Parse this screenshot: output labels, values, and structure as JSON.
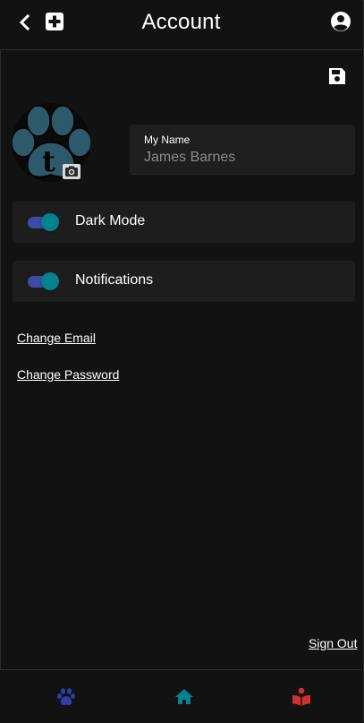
{
  "header": {
    "title": "Account"
  },
  "profile": {
    "name_field": {
      "label": "My Name",
      "value": "James Barnes"
    }
  },
  "settings": {
    "dark_mode": {
      "label": "Dark Mode",
      "enabled": true
    },
    "notifications": {
      "label": "Notifications",
      "enabled": true
    }
  },
  "links": {
    "change_email": "Change Email",
    "change_password": "Change Password",
    "sign_out": "Sign Out"
  },
  "icons": {
    "back": "chevron-left-icon",
    "add": "plus-square-icon",
    "account": "account-circle-icon",
    "save": "floppy-disk-icon",
    "camera": "camera-plus-icon",
    "nav_pets": "paw-icon",
    "nav_home": "home-icon",
    "nav_learn": "book-reader-icon"
  },
  "colors": {
    "background": "#121212",
    "surface": "#1d1d1d",
    "toggle_track": "#3f4aa8",
    "toggle_thumb": "#00838f",
    "paw_nav": "#2f3fa8",
    "home_nav": "#00838f",
    "learn_nav": "#d32f2f",
    "avatar_paw": "#2d5a6b"
  }
}
